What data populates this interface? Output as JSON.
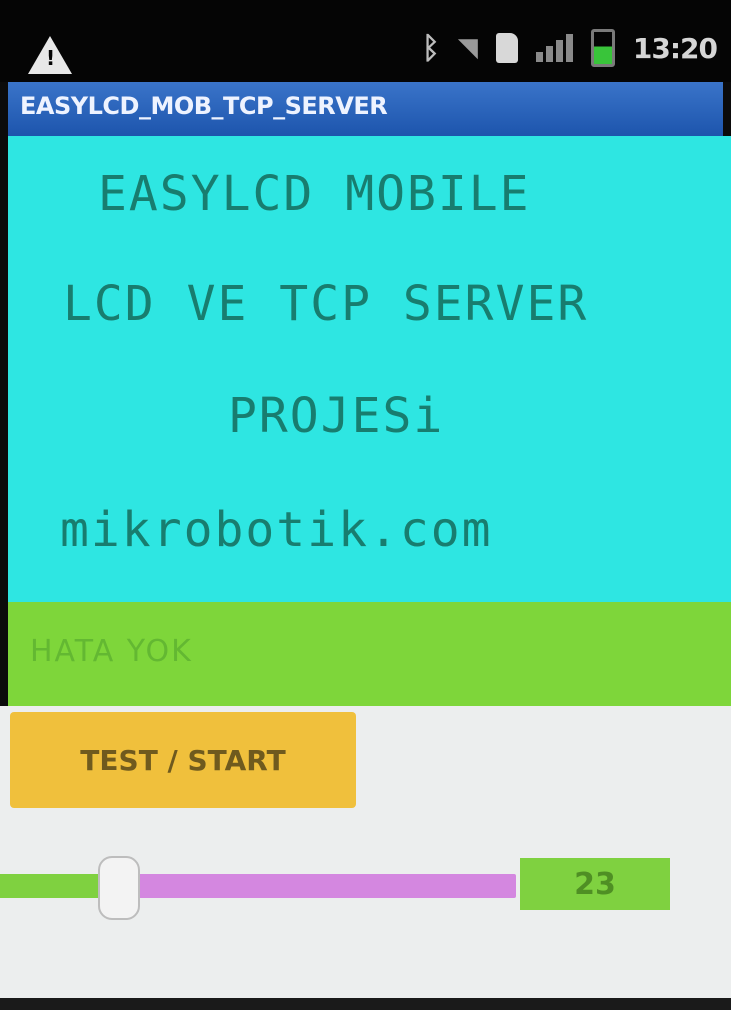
{
  "status_bar": {
    "time": "13:20",
    "icons": [
      "warning-icon",
      "bluetooth-icon",
      "wifi-icon",
      "sd-card-icon",
      "signal-icon",
      "battery-icon"
    ]
  },
  "app": {
    "title": "EASYLCD_MOB_TCP_SERVER"
  },
  "lcd": {
    "background_color": "#2ee6e2",
    "text_color": "#187d6f",
    "lines": [
      "EASYLCD MOBILE",
      "LCD VE TCP SERVER",
      "PROJESi",
      "mikrobotik.com"
    ]
  },
  "status_message": {
    "text": "HATA YOK",
    "background_color": "#7ed63a"
  },
  "controls": {
    "test_button_label": "TEST / START",
    "slider": {
      "value": 23,
      "min": 0,
      "max": 100
    },
    "value_display": "23"
  }
}
